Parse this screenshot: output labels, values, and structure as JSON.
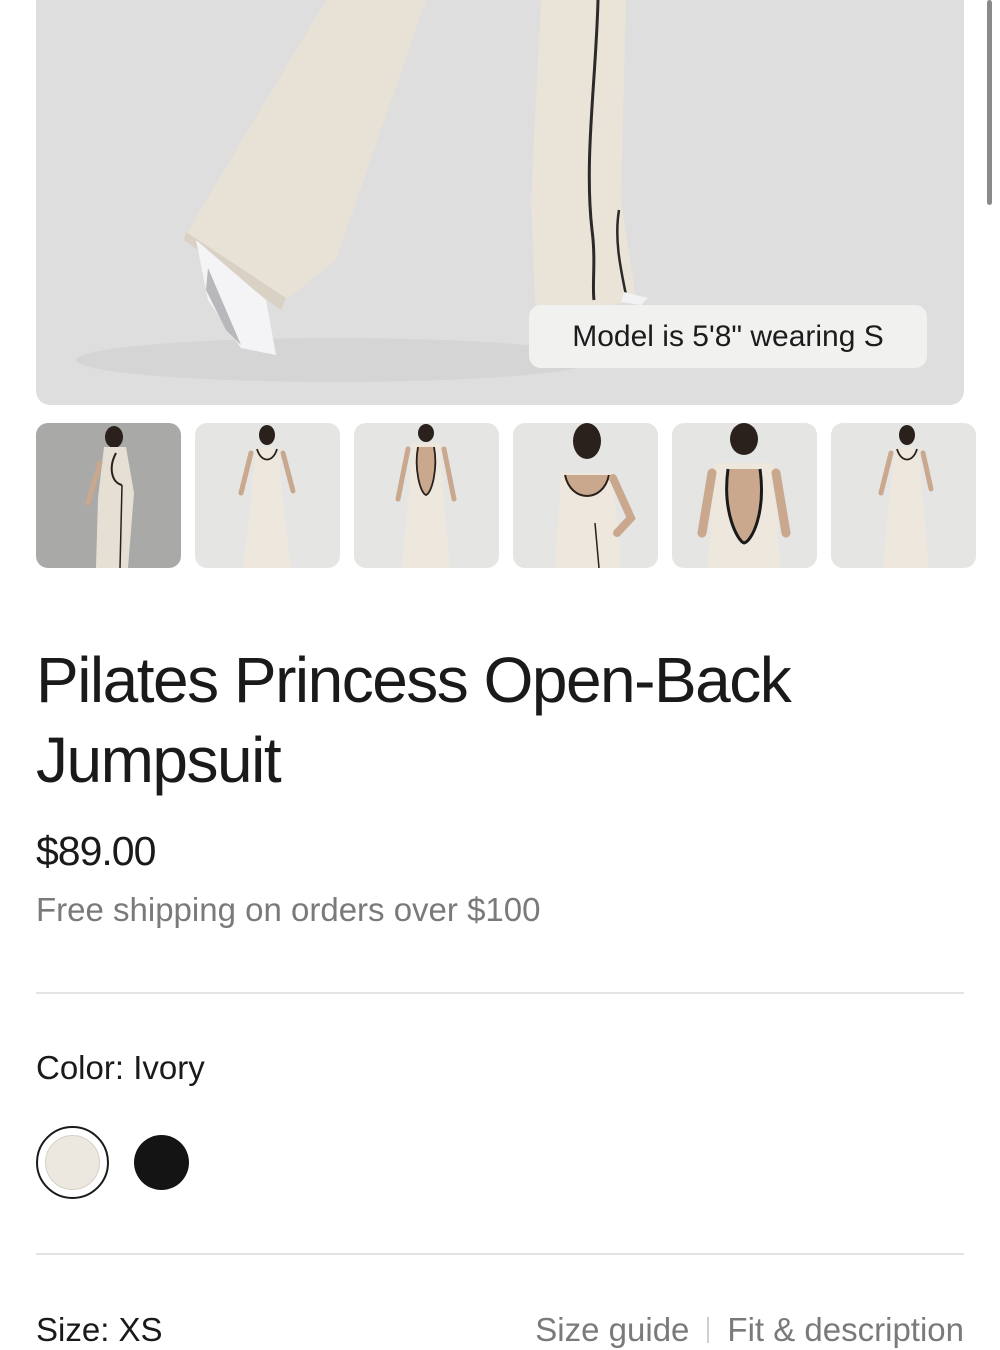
{
  "hero": {
    "model_badge": "Model is 5'8\" wearing S"
  },
  "thumbnails": [
    {
      "name": "thumb-1",
      "pose": "back-side",
      "active": true
    },
    {
      "name": "thumb-2",
      "pose": "front"
    },
    {
      "name": "thumb-3",
      "pose": "back"
    },
    {
      "name": "thumb-4",
      "pose": "front-closeup"
    },
    {
      "name": "thumb-5",
      "pose": "back-closeup"
    },
    {
      "name": "thumb-6",
      "pose": "front"
    }
  ],
  "product": {
    "title": "Pilates Princess Open-Back Jumpsuit",
    "price": "$89.00",
    "shipping_note": "Free shipping on orders over $100"
  },
  "color": {
    "label": "Color: Ivory",
    "options": [
      {
        "name": "Ivory",
        "hex": "#ece7df",
        "selected": true
      },
      {
        "name": "Black",
        "hex": "#141414",
        "selected": false
      }
    ]
  },
  "size": {
    "label": "Size: XS",
    "size_guide_link": "Size guide",
    "fit_link": "Fit & description"
  },
  "colors": {
    "text_primary": "#1a1a1a",
    "text_secondary": "#7a7a7a",
    "image_bg": "#dedede",
    "divider": "#e3e3e3"
  }
}
